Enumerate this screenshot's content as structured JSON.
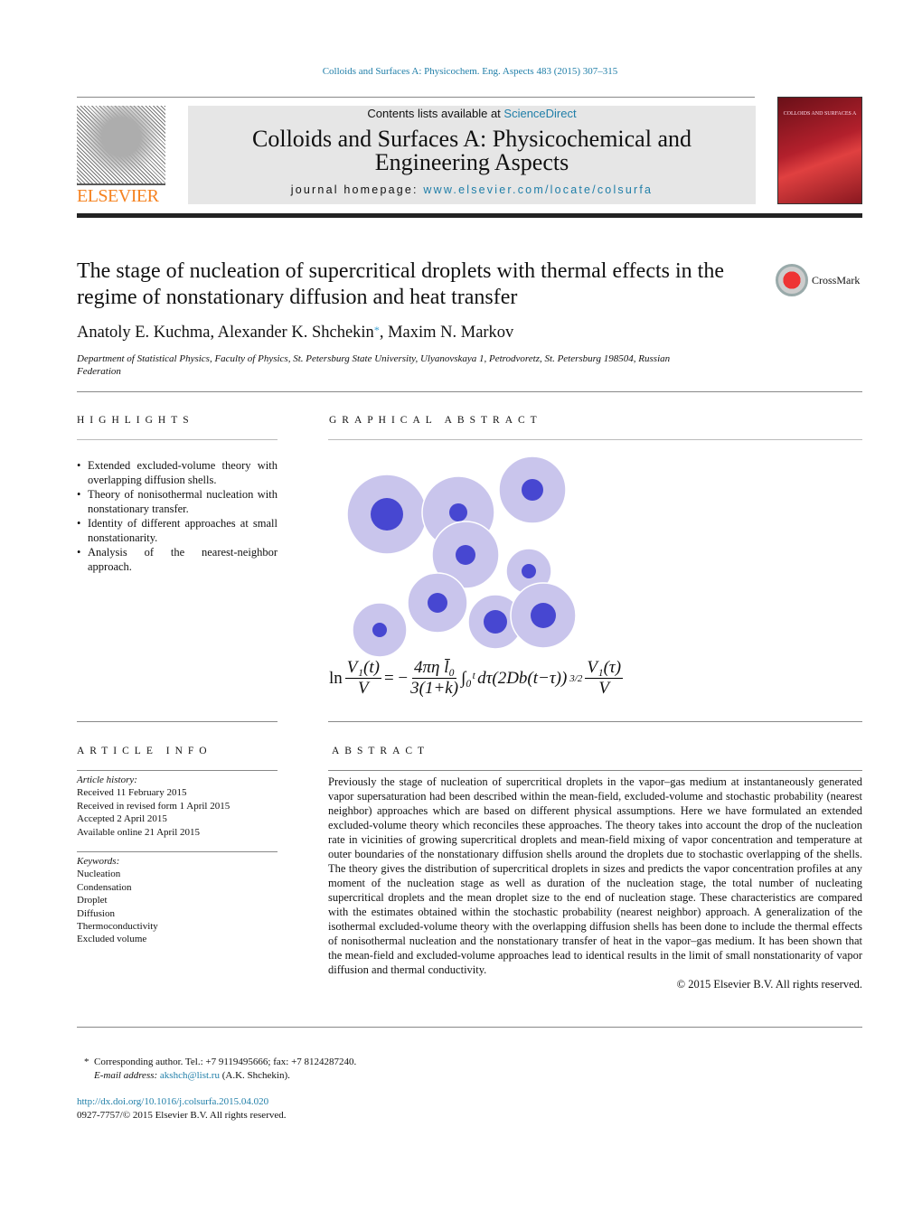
{
  "citation": "Colloids and Surfaces A: Physicochem. Eng. Aspects 483 (2015) 307–315",
  "header": {
    "publisher": "ELSEVIER",
    "contents_prefix": "Contents lists available at ",
    "contents_link": "ScienceDirect",
    "journal_title_1": "Colloids and Surfaces A: Physicochemical and",
    "journal_title_2": "Engineering Aspects",
    "homepage_prefix": "journal homepage: ",
    "homepage_link": "www.elsevier.com/locate/colsurfa",
    "cover_text": "COLLOIDS AND SURFACES A",
    "crossmark": "CrossMark"
  },
  "article": {
    "title": "The stage of nucleation of supercritical droplets with thermal effects in the regime of nonstationary diffusion and heat transfer",
    "authors_a": "Anatoly E. Kuchma, Alexander K. Shchekin",
    "author_star": "*",
    "authors_b": ", Maxim N. Markov",
    "affiliation": "Department of Statistical Physics, Faculty of Physics, St. Petersburg State University, Ulyanovskaya 1, Petrodvoretz, St. Petersburg 198504, Russian Federation"
  },
  "highlights": {
    "heading": "HIGHLIGHTS",
    "items": [
      "Extended excluded-volume theory with overlapping diffusion shells.",
      "Theory of nonisothermal nucleation with nonstationary transfer.",
      "Identity of different approaches at small nonstationarity.",
      "Analysis of the nearest-neighbor approach."
    ]
  },
  "graphical_abstract": {
    "heading": "GRAPHICAL ABSTRACT",
    "colors": {
      "shell": "#c9c5ec",
      "droplet": "#4747d1"
    },
    "formula": {
      "ln": "ln",
      "lhs_num": "V₁(t)",
      "lhs_den": "V",
      "eq": "= −",
      "c_num": "4πη l̄₀",
      "c_den": "3(1+k)",
      "integral": "∫₀ᵗ",
      "body": "dτ(2Db(t−τ))",
      "power": "3/2",
      "r_num": "V₁(τ)",
      "r_den": "V"
    }
  },
  "article_info": {
    "heading": "ARTICLE INFO",
    "history_label": "Article history:",
    "history": [
      "Received 11 February 2015",
      "Received in revised form 1 April 2015",
      "Accepted 2 April 2015",
      "Available online 21 April 2015"
    ],
    "keywords_label": "Keywords:",
    "keywords": [
      "Nucleation",
      "Condensation",
      "Droplet",
      "Diffusion",
      "Thermoconductivity",
      "Excluded volume"
    ]
  },
  "abstract": {
    "heading": "ABSTRACT",
    "text": "Previously the stage of nucleation of supercritical droplets in the vapor–gas medium at instantaneously generated vapor supersaturation had been described within the mean-field, excluded-volume and stochastic probability (nearest neighbor) approaches which are based on different physical assumptions. Here we have formulated an extended excluded-volume theory which reconciles these approaches. The theory takes into account the drop of the nucleation rate in vicinities of growing supercritical droplets and mean-field mixing of vapor concentration and temperature at outer boundaries of the nonstationary diffusion shells around the droplets due to stochastic overlapping of the shells. The theory gives the distribution of supercritical droplets in sizes and predicts the vapor concentration profiles at any moment of the nucleation stage as well as duration of the nucleation stage, the total number of nucleating supercritical droplets and the mean droplet size to the end of nucleation stage. These characteristics are compared with the estimates obtained within the stochastic probability (nearest neighbor) approach. A generalization of the isothermal excluded-volume theory with the overlapping diffusion shells has been done to include the thermal effects of nonisothermal nucleation and the nonstationary transfer of heat in the vapor–gas medium. It has been shown that the mean-field and excluded-volume approaches lead to identical results in the limit of small nonstationarity of vapor diffusion and thermal conductivity.",
    "copyright": "© 2015 Elsevier B.V. All rights reserved."
  },
  "footnote": {
    "star": "*",
    "corresponding": "Corresponding author. Tel.: +7 9119495666; fax: +7 8124287240.",
    "email_label": "E-mail address: ",
    "email": "akshch@list.ru",
    "email_suffix": " (A.K. Shchekin).",
    "doi": "http://dx.doi.org/10.1016/j.colsurfa.2015.04.020",
    "issn": "0927-7757/© 2015 Elsevier B.V. All rights reserved."
  }
}
